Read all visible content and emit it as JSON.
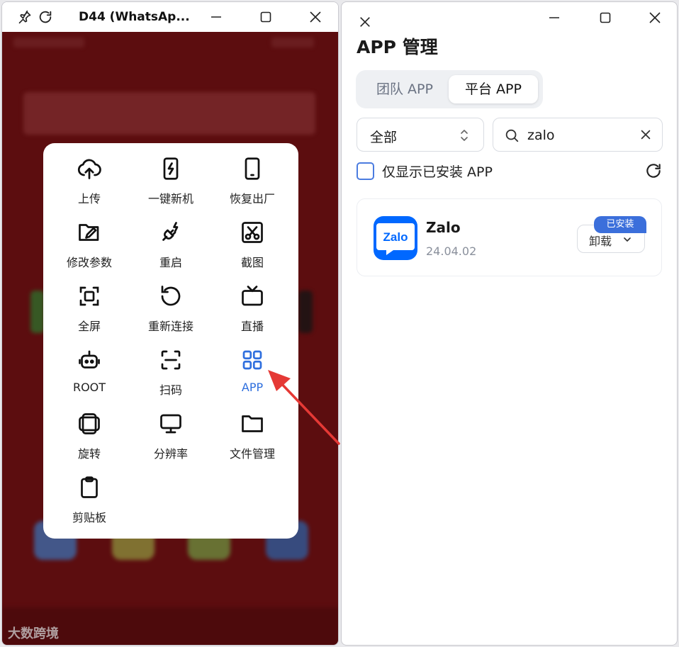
{
  "phone_window": {
    "title": "D44  (WhatsAp...",
    "icons": [
      "pin-icon",
      "reload-icon",
      "minimize-icon",
      "maximize-icon",
      "close-icon"
    ],
    "tools": [
      {
        "label": "上传",
        "icon": "upload-cloud-icon"
      },
      {
        "label": "一键新机",
        "icon": "new-device-icon"
      },
      {
        "label": "恢复出厂",
        "icon": "phone-icon"
      },
      {
        "label": "修改参数",
        "icon": "edit-folder-icon"
      },
      {
        "label": "重启",
        "icon": "plug-icon"
      },
      {
        "label": "截图",
        "icon": "scissors-icon"
      },
      {
        "label": "全屏",
        "icon": "fullscreen-icon"
      },
      {
        "label": "重新连接",
        "icon": "rotate-icon"
      },
      {
        "label": "直播",
        "icon": "tv-icon"
      },
      {
        "label": "ROOT",
        "icon": "robot-icon"
      },
      {
        "label": "扫码",
        "icon": "scan-icon"
      },
      {
        "label": "APP",
        "icon": "grid-icon",
        "active": true
      },
      {
        "label": "旋转",
        "icon": "rotate-device-icon"
      },
      {
        "label": "分辨率",
        "icon": "monitor-icon"
      },
      {
        "label": "文件管理",
        "icon": "folder-icon"
      },
      {
        "label": "剪贴板",
        "icon": "clipboard-icon"
      }
    ],
    "watermark": "大数跨境",
    "accent_color": "#2f6fde",
    "arrow_color": "#e53935"
  },
  "app_window": {
    "title": "APP 管理",
    "tabs": [
      {
        "label": "团队 APP",
        "selected": false
      },
      {
        "label": "平台 APP",
        "selected": true
      }
    ],
    "category_select": {
      "value": "全部"
    },
    "search": {
      "value": "zalo",
      "placeholder": ""
    },
    "installed_only": {
      "label": "仅显示已安装 APP",
      "checked": false
    },
    "apps": [
      {
        "name": "Zalo",
        "version": "24.04.02",
        "logo_text": "Zalo",
        "badge": "已安装",
        "action": "卸载"
      }
    ],
    "brand_color": "#3b6fdb"
  }
}
